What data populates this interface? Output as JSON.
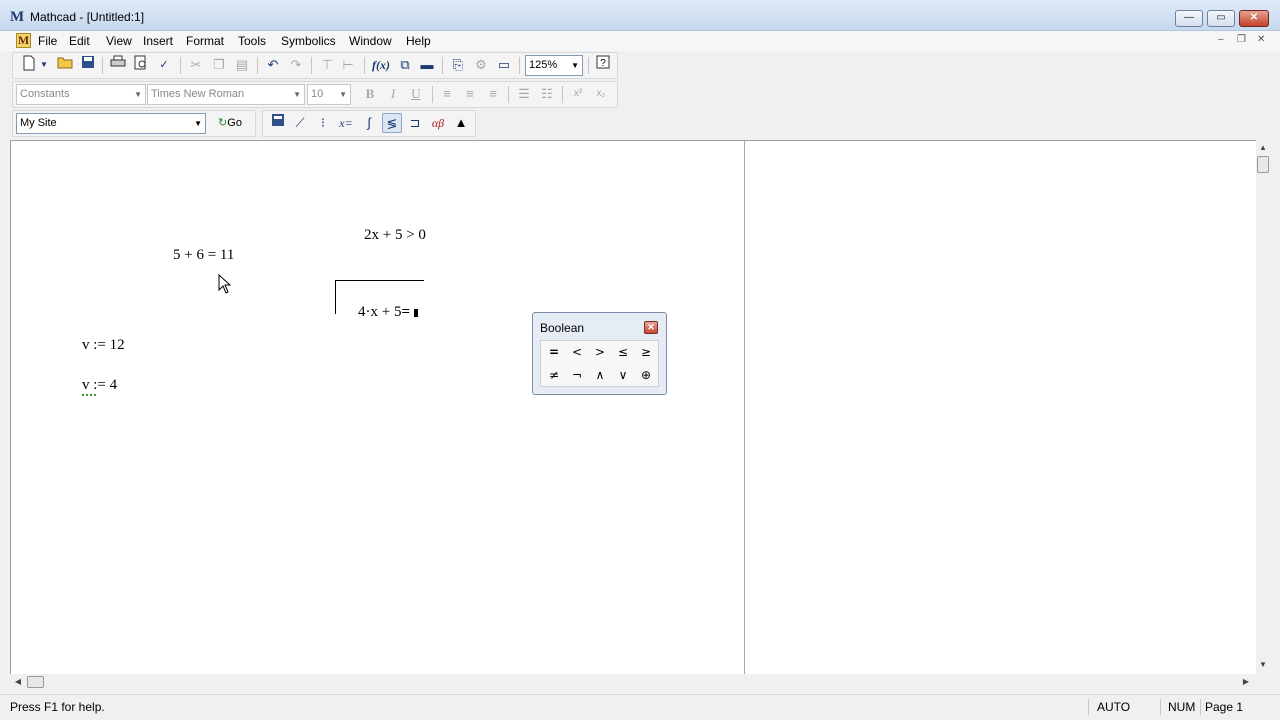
{
  "window": {
    "app_icon": "M",
    "title": "Mathcad - [Untitled:1]",
    "controls": {
      "minimize": "—",
      "maximize": "▭",
      "close": "✕"
    }
  },
  "menubar": {
    "doc_icon": "M",
    "items": [
      "File",
      "Edit",
      "View",
      "Insert",
      "Format",
      "Tools",
      "Symbolics",
      "Window",
      "Help"
    ],
    "mdi_controls": {
      "minimize": "–",
      "restore": "❐",
      "close": "✕"
    }
  },
  "standard_toolbar": {
    "icons": [
      "new-icon",
      "open-icon",
      "save-icon",
      "print-icon",
      "print-preview-icon",
      "spellcheck-icon",
      "cut-icon",
      "copy-icon",
      "paste-icon",
      "undo-icon",
      "redo-icon",
      "align-across-icon",
      "align-down-icon",
      "insert-function-icon",
      "insert-unit-icon",
      "calculate-icon",
      "component-icon",
      "resource-center-icon",
      "insert-region-icon",
      "help-icon"
    ],
    "zoom": "125%"
  },
  "formatting_toolbar": {
    "style": "Constants",
    "font": "Times New Roman",
    "size": "10",
    "bold": "B",
    "italic": "I",
    "underline": "U",
    "superscript": "x²",
    "subscript": "x₂"
  },
  "resources_toolbar": {
    "site": "My Site",
    "go_label": "Go",
    "math_palette_icons": [
      "calculator-palette-icon",
      "graph-palette-icon",
      "matrix-palette-icon",
      "evaluation-palette-icon",
      "calculus-palette-icon",
      "boolean-palette-icon",
      "programming-palette-icon",
      "greek-palette-icon",
      "symbolic-palette-icon"
    ],
    "evaluation_glyph": "x=",
    "greek_glyph": "αβ"
  },
  "worksheet": {
    "regions": {
      "inequality": "2x + 5 > 0",
      "sum": "5 + 6 = 11",
      "editing_lhs": "4·x + 5",
      "editing_op": "=",
      "def_v": "v := 12",
      "redef_v_name": "v",
      "redef_v_rest": " := 4"
    }
  },
  "boolean_palette": {
    "title": "Boolean",
    "row1": [
      "=",
      "<",
      ">",
      "≤",
      "≥"
    ],
    "row2": [
      "≠",
      "¬",
      "∧",
      "∨",
      "⊕"
    ]
  },
  "statusbar": {
    "help": "Press F1 for help.",
    "mode": "AUTO",
    "num": "NUM",
    "page": "Page 1"
  }
}
